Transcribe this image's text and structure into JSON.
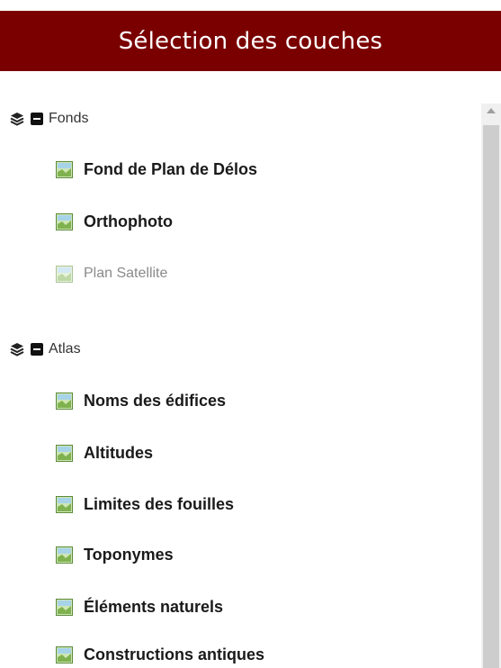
{
  "colors": {
    "header_bg": "#7a0000",
    "scroll_track": "#f0f0f0",
    "scroll_thumb": "#cdcdcd"
  },
  "header": {
    "title": "Sélection des couches"
  },
  "groups": [
    {
      "label": "Fonds",
      "icon": "layers-icon",
      "toggle_icon": "collapse-icon",
      "items": [
        {
          "label": "Fond de Plan de Délos",
          "icon": "layer-icon",
          "enabled": true
        },
        {
          "label": "Orthophoto",
          "icon": "layer-icon",
          "enabled": true
        },
        {
          "label": "Plan Satellite",
          "icon": "layer-icon",
          "enabled": false
        }
      ]
    },
    {
      "label": "Atlas",
      "icon": "layers-icon",
      "toggle_icon": "collapse-icon",
      "items": [
        {
          "label": "Noms des édifices",
          "icon": "layer-icon",
          "enabled": true
        },
        {
          "label": "Altitudes",
          "icon": "layer-icon",
          "enabled": true
        },
        {
          "label": "Limites des fouilles",
          "icon": "layer-icon",
          "enabled": true
        },
        {
          "label": "Toponymes",
          "icon": "layer-icon",
          "enabled": true
        },
        {
          "label": "Éléments naturels",
          "icon": "layer-icon",
          "enabled": true
        },
        {
          "label": "Constructions antiques",
          "icon": "layer-icon",
          "enabled": true
        }
      ]
    }
  ]
}
